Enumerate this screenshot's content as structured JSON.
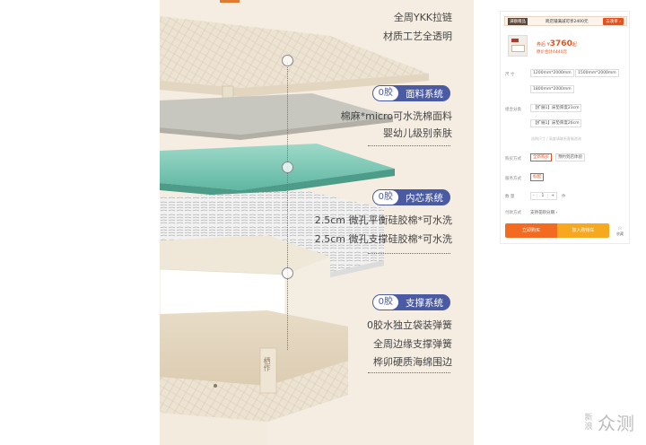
{
  "hero": {
    "captions_top": [
      "全周YKK拉链",
      "材质工艺全透明"
    ],
    "sections": [
      {
        "zero": "0胶",
        "title": "面料系统",
        "lines": [
          "棉麻*micro可水洗棉面料",
          "婴幼儿级别亲肤"
        ]
      },
      {
        "zero": "0胶",
        "title": "内芯系统",
        "lines": [
          "2.5cm 微孔平衡硅胶棉*可水洗",
          "2.5cm 微孔支撑硅胶棉*可水洗"
        ]
      },
      {
        "zero": "0胶",
        "title": "支撑系统",
        "lines": [
          "0胶水独立袋装弹簧",
          "全周边缘支撑弹簧",
          "桦卯硬质海绵围边"
        ]
      }
    ],
    "brand_label": "栖作",
    "colors": {
      "background": "#f5ede2",
      "pill": "#4a5aa3",
      "accent": "#e07a2e"
    }
  },
  "buy_panel": {
    "promo_tag": "满额赠品",
    "promo_text": "跨店铺满减可享2400元",
    "promo_button": "去凑单 ›",
    "price_prefix": "券后 ¥",
    "price": "3760",
    "price_suffix": "起",
    "sub_price": "原价合计4440元",
    "size_label": "尺 寸",
    "sizes": [
      "1200mm*2000mm",
      "1500mm*2000mm",
      "1800mm*2000mm"
    ],
    "combo_label": "组合分类",
    "combos": [
      "【扩展1】床垫厚度23cm",
      "【扩展1】床垫厚度26cm"
    ],
    "combo_hint": "选购尺寸 / 高度请联系客服咨询",
    "delivery_label": "购买方式",
    "delivery_options": [
      "全新购买",
      "预约到店体验"
    ],
    "service_label": "服务方式",
    "service_option": "标配",
    "qty_label": "数 量",
    "qty_minus": "-",
    "qty_value": "1",
    "qty_plus": "+",
    "qty_unit": "件",
    "payment_label": "付款方式",
    "payment_value": "支持花呗分期 ›",
    "buy_now": "立即购买",
    "add_cart": "加入购物车",
    "fav_label": "收藏",
    "colors": {
      "primary": "#f26b21",
      "secondary": "#f6a81f"
    }
  },
  "watermark": {
    "stack": [
      "新",
      "浪"
    ],
    "big": "众测"
  }
}
